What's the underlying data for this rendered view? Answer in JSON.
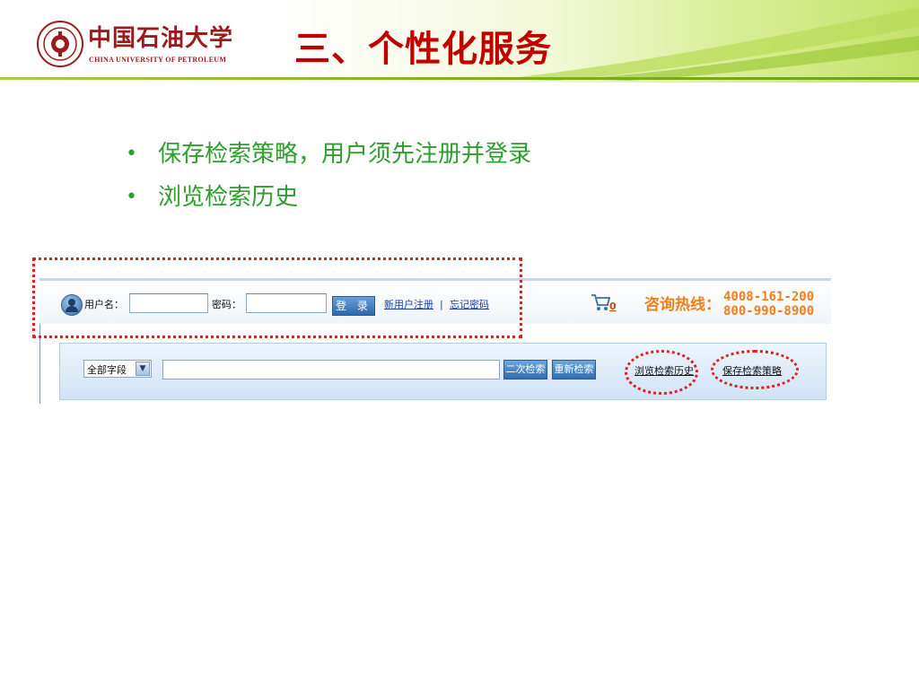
{
  "header": {
    "logo_cn": "中国石油大学",
    "logo_en": "CHINA UNIVERSITY OF PETROLEUM",
    "slide_title": "三、个性化服务"
  },
  "bullets": [
    "保存检索策略，用户须先注册并登录",
    "浏览检索历史"
  ],
  "bullet_symbol": "•",
  "screenshot": {
    "login": {
      "username_label": "用户名：",
      "password_label": "密码：",
      "login_button": "登 录",
      "register_link": "新用户注册",
      "separator": "|",
      "forgot_link": "忘记密码"
    },
    "cart_count": "0",
    "hotline_label": "咨询热线：",
    "hotline_numbers": [
      "4008-161-200",
      "800-990-8900"
    ],
    "search": {
      "field_select_value": "全部字段",
      "secondary_search_button": "二次检索",
      "new_search_button": "重新检索",
      "browse_history_link": "浏览检索历史",
      "save_strategy_link": "保存检索策略"
    }
  },
  "colors": {
    "title_red": "#c00000",
    "bullet_green": "#2e9e2e",
    "annotation_red": "#e02020",
    "hotline_orange": "#ef7f1a",
    "link_blue": "#1a3fa8",
    "button_blue": "#2f6db3"
  },
  "icons": [
    "university-seal-icon",
    "user-icon",
    "cart-icon",
    "dropdown-arrow-icon"
  ]
}
